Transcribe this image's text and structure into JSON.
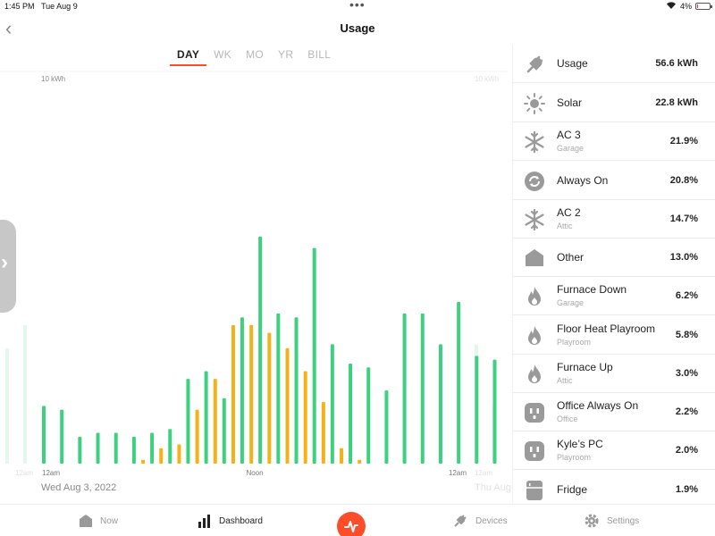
{
  "status": {
    "time": "1:45 PM",
    "date": "Tue Aug 9",
    "battery": "4%",
    "battery_level": 0.04
  },
  "header": {
    "title": "Usage"
  },
  "tabs": [
    {
      "label": "DAY",
      "active": true
    },
    {
      "label": "WK",
      "active": false
    },
    {
      "label": "MO",
      "active": false
    },
    {
      "label": "YR",
      "active": false
    },
    {
      "label": "BILL",
      "active": false
    }
  ],
  "chart": {
    "top_label": "10 kWh",
    "top_label_ghost": "10 kWh",
    "x_labels": [
      "12am",
      "Noon",
      "12am"
    ],
    "x_label_ghost_left": "12am",
    "x_label_ghost_right": "12am",
    "date": "Wed Aug 3, 2022",
    "date_ghost": "Thu Aug"
  },
  "chart_data": {
    "type": "bar",
    "ylim": [
      0,
      10
    ],
    "y_tick_label": "10 kWh",
    "x_ticks": [
      "12am",
      "Noon",
      "12am"
    ],
    "colors": {
      "usage": "#3dd17f",
      "solar": "#f5b119"
    },
    "ghost_previous_day": [
      3.0,
      3.6
    ],
    "ghost_next_day": [
      3.1,
      1.5
    ],
    "series": [
      {
        "values": [
          1.5,
          1.4,
          0.7,
          0.8,
          0.8,
          0.7,
          0.8,
          0.9,
          2.2,
          2.4,
          1.7,
          3.8,
          5.9,
          3.9,
          3.8,
          5.6,
          3.1,
          2.6,
          2.5,
          1.9,
          3.9,
          3.9,
          3.1,
          4.2,
          2.8,
          2.7
        ]
      },
      {
        "values": [
          0,
          0,
          0,
          0,
          0,
          0,
          0.1,
          0.4,
          0.5,
          1.4,
          2.2,
          3.6,
          3.6,
          3.4,
          3.0,
          2.4,
          1.6,
          0.4,
          0.1,
          0,
          0,
          0,
          0,
          0,
          0,
          0
        ]
      }
    ]
  },
  "panel": {
    "rows": [
      {
        "icon": "plug-icon",
        "name": "Usage",
        "sub": "",
        "value": "56.6 kWh"
      },
      {
        "icon": "sun-icon",
        "name": "Solar",
        "sub": "",
        "value": "22.8 kWh"
      },
      {
        "icon": "snowflake-icon",
        "name": "AC 3",
        "sub": "Garage",
        "value": "21.9%"
      },
      {
        "icon": "always-on-icon",
        "name": "Always On",
        "sub": "",
        "value": "20.8%"
      },
      {
        "icon": "snowflake-icon",
        "name": "AC 2",
        "sub": "Attic",
        "value": "14.7%"
      },
      {
        "icon": "other-icon",
        "name": "Other",
        "sub": "",
        "value": "13.0%"
      },
      {
        "icon": "flame-icon",
        "name": "Furnace Down",
        "sub": "Garage",
        "value": "6.2%"
      },
      {
        "icon": "flame-icon",
        "name": "Floor Heat Playroom",
        "sub": "Playroom",
        "value": "5.8%"
      },
      {
        "icon": "flame-icon",
        "name": "Furnace Up",
        "sub": "Attic",
        "value": "3.0%"
      },
      {
        "icon": "outlet-icon",
        "name": "Office Always On",
        "sub": "Office",
        "value": "2.2%"
      },
      {
        "icon": "outlet-icon",
        "name": "Kyle’s PC",
        "sub": "Playroom",
        "value": "2.0%"
      },
      {
        "icon": "fridge-icon",
        "name": "Fridge",
        "sub": "",
        "value": "1.9%"
      }
    ]
  },
  "tabbar": {
    "now": "Now",
    "dashboard": "Dashboard",
    "devices": "Devices",
    "settings": "Settings"
  }
}
